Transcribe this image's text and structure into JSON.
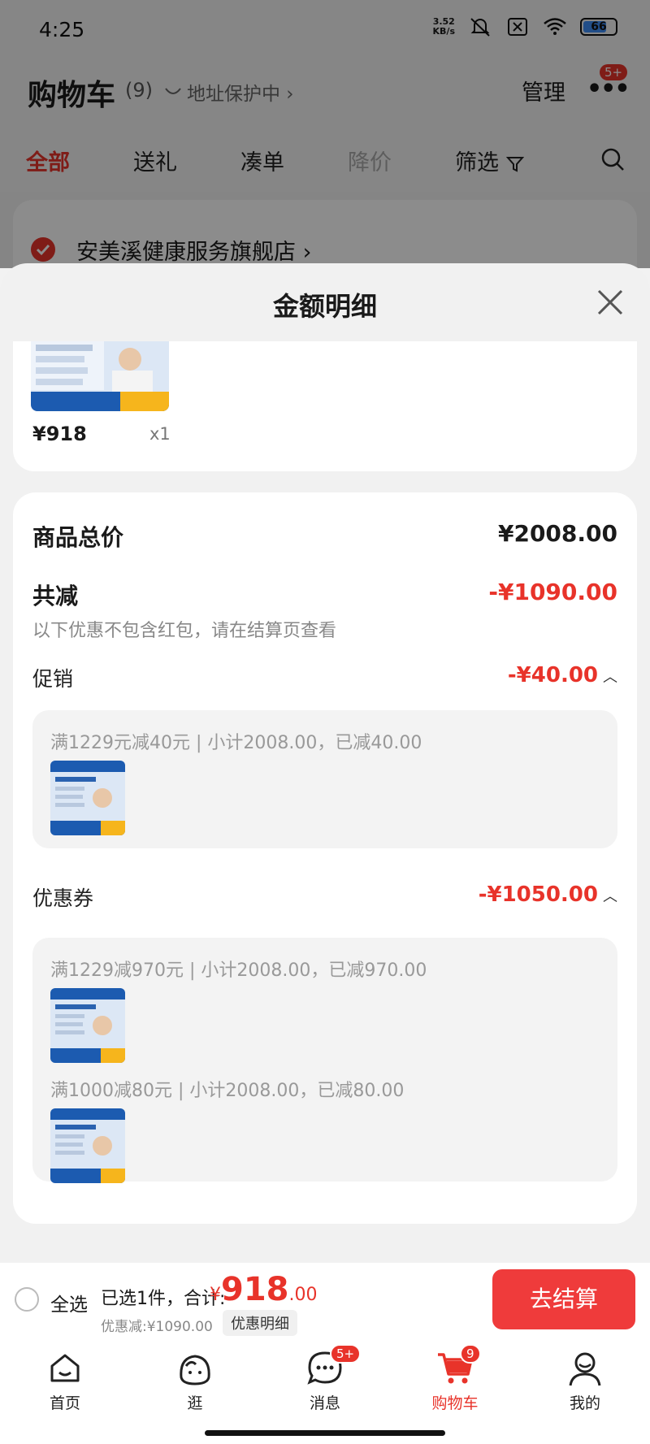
{
  "status_bar": {
    "time": "4:25",
    "net_speed_value": "3.52",
    "net_speed_unit": "KB/s",
    "battery": "66"
  },
  "cart_header": {
    "title": "购物车",
    "count": "(9)",
    "address_protection": "地址保护中 ›",
    "manage": "管理",
    "more_badge": "5+"
  },
  "cart_tabs": [
    "全部",
    "送礼",
    "凑单",
    "降价",
    "筛选"
  ],
  "shop": {
    "name": "安美溪健康服务旗舰店 ›"
  },
  "sheet": {
    "title": "金额明细",
    "product": {
      "price": "¥918",
      "quantity": "x1"
    },
    "total_label": "商品总价",
    "total_value": "¥2008.00",
    "discount_label": "共减",
    "discount_value": "-¥1090.00",
    "discount_note": "以下优惠不包含红包，请在结算页查看",
    "promotion": {
      "label": "促销",
      "value": "-¥40.00",
      "rules": [
        "满1229元减40元 | 小计2008.00，已减40.00"
      ]
    },
    "coupon": {
      "label": "优惠券",
      "value": "-¥1050.00",
      "rules": [
        "满1229减970元 | 小计2008.00，已减970.00",
        "满1000减80元 | 小计2008.00，已减80.00"
      ]
    }
  },
  "checkout_bar": {
    "select_all": "全选",
    "selected_text": "已选1件，合计:",
    "total_symbol": "¥",
    "total_int": "918",
    "total_dec": ".00",
    "saved": "优惠减:¥1090.00",
    "detail_button": "优惠明细",
    "checkout_button": "去结算"
  },
  "tabbar": {
    "items": [
      {
        "label": "首页",
        "icon": "home-icon"
      },
      {
        "label": "逛",
        "icon": "browse-icon"
      },
      {
        "label": "消息",
        "icon": "message-icon",
        "badge": "5+"
      },
      {
        "label": "购物车",
        "icon": "cart-icon",
        "badge": "9"
      },
      {
        "label": "我的",
        "icon": "profile-icon"
      }
    ]
  },
  "colors": {
    "accent": "#e8332a",
    "checkout": "#ef3b3b"
  }
}
